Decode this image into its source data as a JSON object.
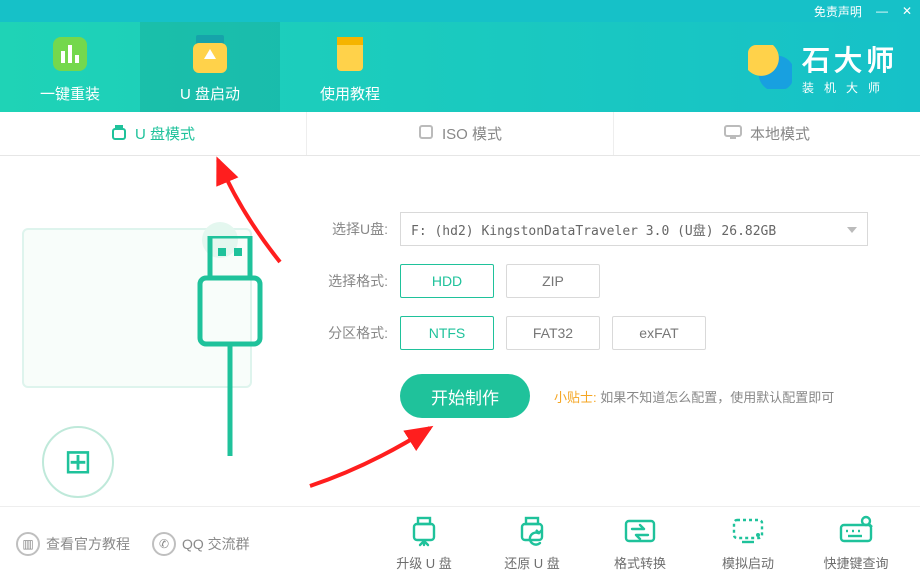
{
  "titlebar": {
    "disclaimer": "免责声明",
    "min": "—",
    "close": "✕"
  },
  "nav": {
    "items": [
      {
        "label": "一键重装"
      },
      {
        "label": "U 盘启动"
      },
      {
        "label": "使用教程"
      }
    ]
  },
  "brand": {
    "name": "石大师",
    "sub": "装机大师"
  },
  "tabs": {
    "items": [
      {
        "label": "U 盘模式"
      },
      {
        "label": "ISO 模式"
      },
      {
        "label": "本地模式"
      }
    ]
  },
  "controls": {
    "disk_label": "选择U盘:",
    "disk_value": "F: (hd2) KingstonDataTraveler 3.0 (U盘) 26.82GB",
    "format_label": "选择格式:",
    "format_options": [
      "HDD",
      "ZIP"
    ],
    "format_selected": "HDD",
    "fs_label": "分区格式:",
    "fs_options": [
      "NTFS",
      "FAT32",
      "exFAT"
    ],
    "fs_selected": "NTFS",
    "action": "开始制作",
    "tip_label": "小贴士:",
    "tip_text": "如果不知道怎么配置，使用默认配置即可"
  },
  "footer": {
    "left": [
      {
        "label": "查看官方教程"
      },
      {
        "label": "QQ 交流群"
      }
    ],
    "right": [
      {
        "label": "升级 U 盘"
      },
      {
        "label": "还原 U 盘"
      },
      {
        "label": "格式转换"
      },
      {
        "label": "模拟启动"
      },
      {
        "label": "快捷键查询"
      }
    ]
  },
  "colors": {
    "accent": "#1fc29b",
    "header1": "#1fd3b6",
    "header2": "#16c1c8",
    "warn": "#f5a623"
  }
}
